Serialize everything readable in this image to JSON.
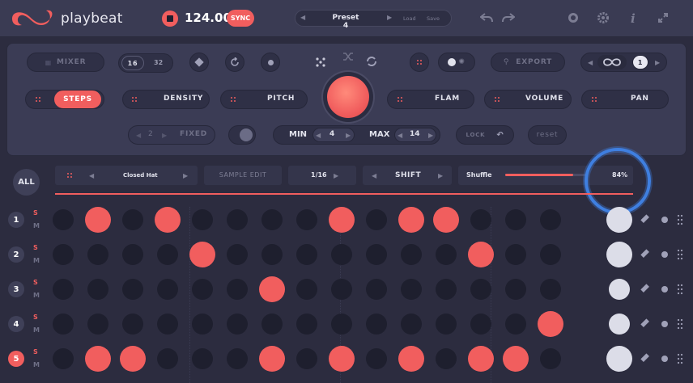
{
  "app": {
    "name": "playbeat"
  },
  "transport": {
    "bpm": "124.00",
    "sync_label": "SYNC"
  },
  "preset": {
    "name": "Preset 4",
    "load_label": "Load",
    "save_label": "Save"
  },
  "controls": {
    "mixer_label": "MIXER",
    "steps_16": "16",
    "steps_32": "32",
    "export_label": "EXPORT",
    "pattern_count": "1",
    "fixed_value": "2",
    "fixed_label": "FIXED",
    "min_label": "MIN",
    "min_value": "4",
    "max_label": "MAX",
    "max_value": "14",
    "lock_label": "LOCK",
    "reset_label": "reset",
    "tabs": [
      "STEPS",
      "DENSITY",
      "PITCH",
      "FLAM",
      "VOLUME",
      "PAN"
    ],
    "active_tab": "STEPS"
  },
  "track": {
    "all_label": "ALL",
    "sample_name": "Closed Hat",
    "sample_edit_label": "SAMPLE EDIT",
    "rate": "1/16",
    "shift_label": "SHIFT",
    "shuffle_label": "Shuffle",
    "shuffle_value": "84%",
    "shuffle_level": 0.84
  },
  "rows": [
    {
      "num": "1",
      "solo": "S",
      "mute": "M",
      "active": false,
      "steps": [
        0,
        1,
        0,
        1,
        0,
        0,
        0,
        0,
        1,
        0,
        1,
        1,
        0,
        0,
        0
      ],
      "velocity_size": 32
    },
    {
      "num": "2",
      "solo": "S",
      "mute": "M",
      "active": false,
      "steps": [
        0,
        0,
        0,
        0,
        1,
        0,
        0,
        0,
        0,
        0,
        0,
        0,
        1,
        0,
        0
      ],
      "velocity_size": 32
    },
    {
      "num": "3",
      "solo": "S",
      "mute": "M",
      "active": false,
      "steps": [
        0,
        0,
        0,
        0,
        0,
        0,
        1,
        0,
        0,
        0,
        0,
        0,
        0,
        0,
        0
      ],
      "velocity_size": 26
    },
    {
      "num": "4",
      "solo": "S",
      "mute": "M",
      "active": false,
      "steps": [
        0,
        0,
        0,
        0,
        0,
        0,
        0,
        0,
        0,
        0,
        0,
        0,
        0,
        0,
        1
      ],
      "velocity_size": 26
    },
    {
      "num": "5",
      "solo": "S",
      "mute": "M",
      "active": true,
      "steps": [
        0,
        1,
        1,
        0,
        0,
        0,
        1,
        0,
        1,
        0,
        1,
        0,
        1,
        1,
        0
      ],
      "velocity_size": 32
    }
  ],
  "colors": {
    "accent": "#f15e5e",
    "background": "#2c2c3f",
    "panel": "#3b3c55",
    "highlight_ring": "#3f7fe0"
  }
}
